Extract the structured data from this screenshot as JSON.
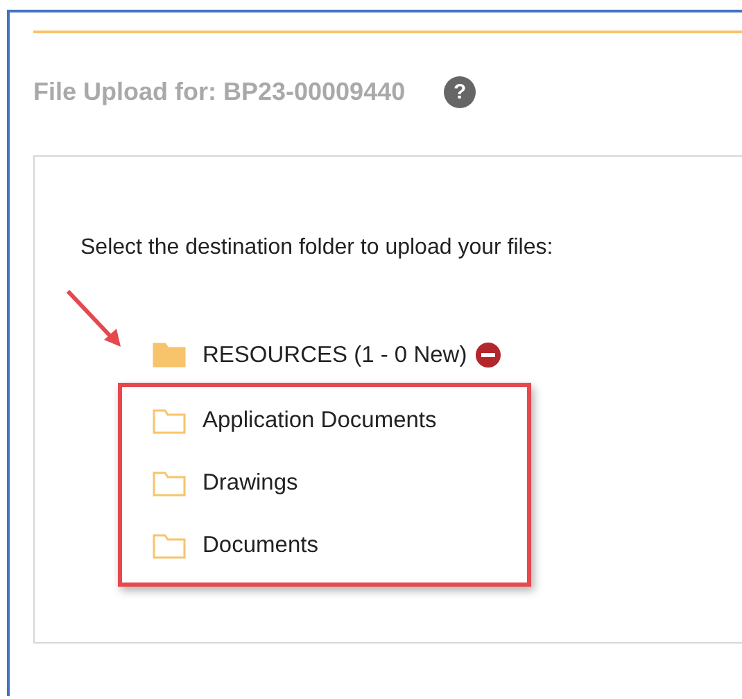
{
  "header": {
    "title": "File Upload for: BP23-00009440",
    "help_icon": "?"
  },
  "panel": {
    "instruction": "Select the destination folder to upload your files:",
    "tree": [
      {
        "label": "RESOURCES (1 - 0 New)",
        "expanded": true,
        "removable": true,
        "children": [
          {
            "label": "Application Documents",
            "expanded": false,
            "removable": false
          },
          {
            "label": "Drawings",
            "expanded": false,
            "removable": false
          },
          {
            "label": "Documents",
            "expanded": false,
            "removable": false
          }
        ]
      }
    ]
  }
}
